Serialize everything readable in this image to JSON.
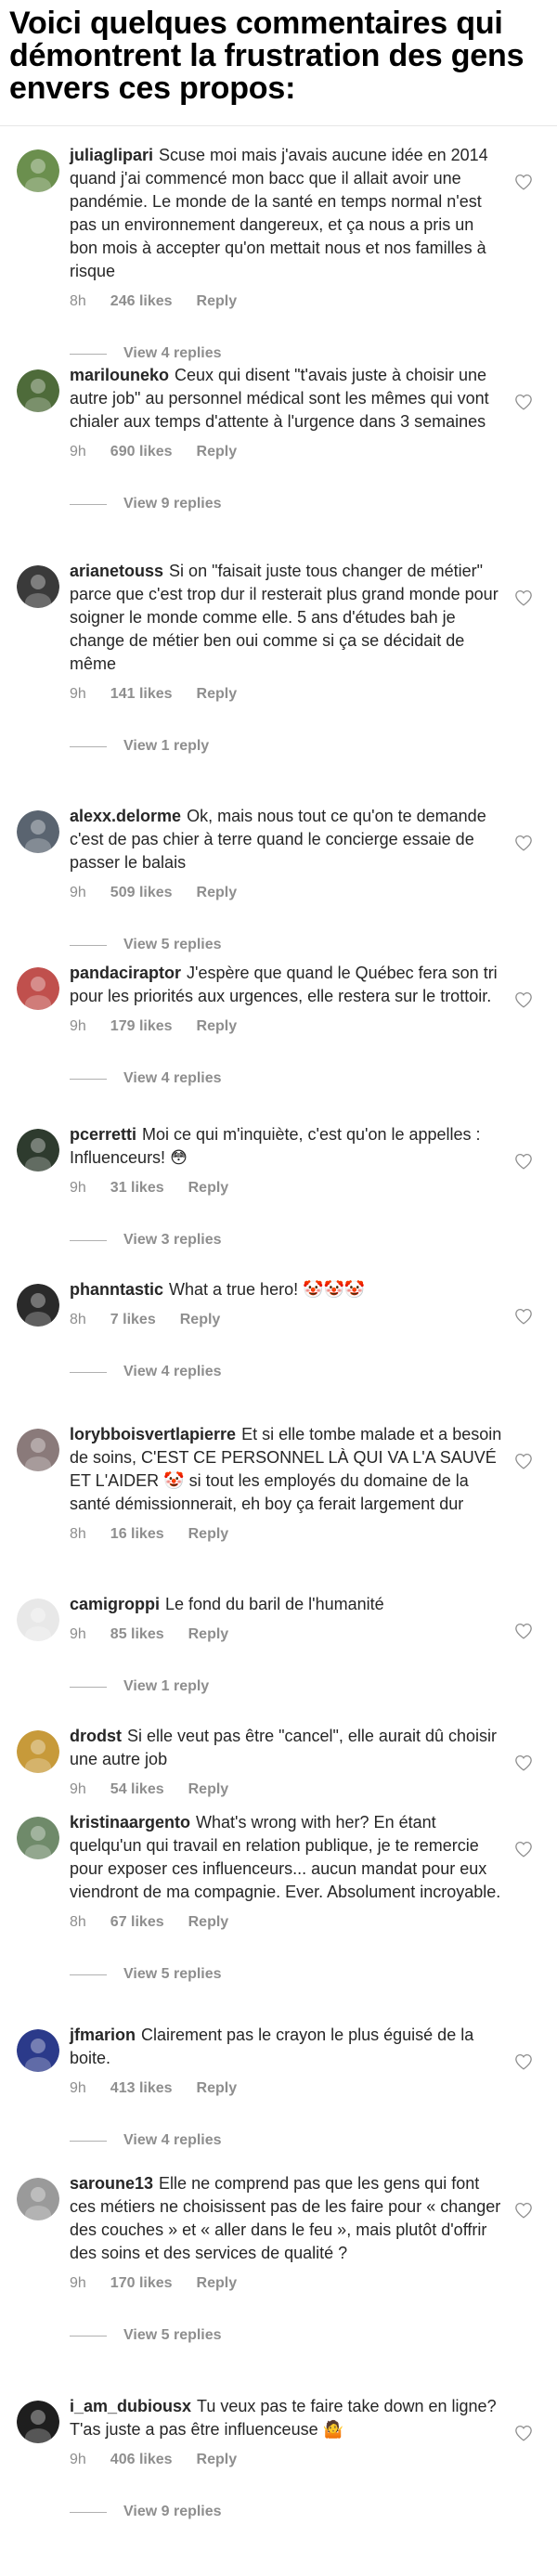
{
  "headline": "Voici quelques commentaires qui démontrent la frustration des gens envers ces propos:",
  "colors": {
    "text": "#262626",
    "muted": "#8e8e8e",
    "divider": "#e6e6e6"
  },
  "comments": [
    {
      "username": "juliaglipari",
      "text": "Scuse moi mais j'avais aucune idée en 2014 quand j'ai commencé mon bacc que il allait avoir une pandémie. Le monde de la santé en temps normal n'est pas un environnement dangereux, et ça nous a pris un bon mois à accepter qu'on mettait nous et nos familles à risque",
      "time": "8h",
      "likes": "246 likes",
      "reply": "Reply",
      "replies": "View 4 replies",
      "avatar": "#6b8f4e"
    },
    {
      "username": "marilouneko",
      "text": "Ceux qui disent \"t'avais juste à choisir une autre job\" au personnel médical sont les mêmes qui vont chialer aux temps d'attente à l'urgence dans 3 semaines",
      "time": "9h",
      "likes": "690 likes",
      "reply": "Reply",
      "replies": "View 9 replies",
      "avatar": "#4e6b3a"
    },
    {
      "username": "arianetouss",
      "text": "Si on \"faisait juste tous changer de métier\" parce que c'est trop dur il resterait plus grand monde pour soigner le monde comme elle. 5 ans d'études bah je change de métier ben oui comme si ça se décidait de même",
      "time": "9h",
      "likes": "141 likes",
      "reply": "Reply",
      "replies": "View 1 reply",
      "avatar": "#3a3a3a"
    },
    {
      "username": "alexx.delorme",
      "text": "Ok, mais nous tout ce qu'on te demande c'est de pas chier à terre quand le concierge essaie de passer le balais",
      "time": "9h",
      "likes": "509 likes",
      "reply": "Reply",
      "replies": "View 5 replies",
      "avatar": "#5a6470"
    },
    {
      "username": "pandaciraptor",
      "text": "J'espère que quand le Québec fera son tri pour les priorités aux urgences, elle restera sur le trottoir.",
      "time": "9h",
      "likes": "179 likes",
      "reply": "Reply",
      "replies": "View 4 replies",
      "avatar": "#c0504d"
    },
    {
      "username": "pcerretti",
      "text": "Moi ce qui m'inquiète, c'est qu'on le appelles : Influenceurs!",
      "emoji": "😳",
      "time": "9h",
      "likes": "31 likes",
      "reply": "Reply",
      "replies": "View 3 replies",
      "avatar": "#2e3b2e"
    },
    {
      "username": "phanntastic",
      "text": "What a true hero!",
      "emoji": "🤡🤡🤡",
      "time": "8h",
      "likes": "7 likes",
      "reply": "Reply",
      "replies": "View 4 replies",
      "avatar": "#2a2a2a"
    },
    {
      "username": "lorybboisvertlapierre",
      "text": "Et si elle tombe malade et a besoin de soins, C'EST CE PERSONNEL LÀ QUI VA L'A SAUVÉ ET L'AIDER",
      "emoji": "🤡",
      "text2": "si tout les employés du domaine de la santé démissionnerait, eh boy ça ferait largement dur",
      "time": "8h",
      "likes": "16 likes",
      "reply": "Reply",
      "replies": null,
      "avatar": "#8a7a7a"
    },
    {
      "username": "camigroppi",
      "text": "Le fond du baril de l'humanité",
      "time": "9h",
      "likes": "85 likes",
      "reply": "Reply",
      "replies": "View 1 reply",
      "avatar": "#e8e8e8"
    },
    {
      "username": "drodst",
      "text": "Si elle veut pas être \"cancel\", elle aurait dû choisir une autre job",
      "time": "9h",
      "likes": "54 likes",
      "reply": "Reply",
      "replies": null,
      "avatar": "#c79a3a"
    },
    {
      "username": "kristinaargento",
      "text": "What's wrong with her? En étant quelqu'un qui travail en relation publique, je te remercie pour exposer ces influenceurs... aucun mandat pour eux viendront de ma compagnie. Ever. Absolument incroyable.",
      "time": "8h",
      "likes": "67 likes",
      "reply": "Reply",
      "replies": "View 5 replies",
      "avatar": "#6f8a6a"
    },
    {
      "username": "jfmarion",
      "text": "Clairement pas le crayon le plus éguisé de la boite.",
      "time": "9h",
      "likes": "413 likes",
      "reply": "Reply",
      "replies": "View 4 replies",
      "avatar": "#2b3a8a"
    },
    {
      "username": "saroune13",
      "text": "Elle ne comprend pas que les gens qui font ces métiers ne choisissent pas de les faire pour « changer des couches » et « aller dans le feu », mais plutôt d'offrir des soins et des services de qualité ?",
      "time": "9h",
      "likes": "170 likes",
      "reply": "Reply",
      "replies": "View 5 replies",
      "avatar": "#9a9a9a"
    },
    {
      "username": "i_am_dubiousx",
      "text": "Tu veux pas te faire take down en ligne? T'as juste a pas être influenceuse",
      "emoji": "🤷",
      "time": "9h",
      "likes": "406 likes",
      "reply": "Reply",
      "replies": "View 9 replies",
      "avatar": "#1e1e1e"
    }
  ]
}
